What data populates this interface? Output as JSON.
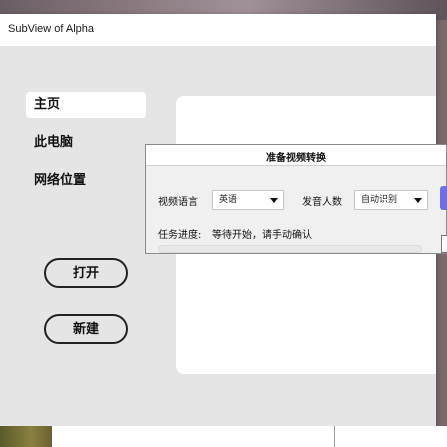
{
  "window": {
    "title": "SubView of Alpha"
  },
  "sidebar": {
    "items": [
      {
        "label": "主页",
        "active": true
      },
      {
        "label": "此电脑",
        "active": false
      },
      {
        "label": "网络位置",
        "active": false
      }
    ]
  },
  "actions": {
    "open_label": "打开",
    "new_label": "新建"
  },
  "dialog": {
    "title": "准备视频转换",
    "language_label": "视频语言",
    "language_value": "英语",
    "speakers_label": "发音人数",
    "speakers_value": "自动识别",
    "progress_label": "任务进度:",
    "progress_status": "等待开始，请手动确认",
    "progress_fraction": 0
  },
  "colors": {
    "accent": "#6e6ee8",
    "window_bg": "#e5e5e5",
    "panel_bg": "#ffffff"
  }
}
